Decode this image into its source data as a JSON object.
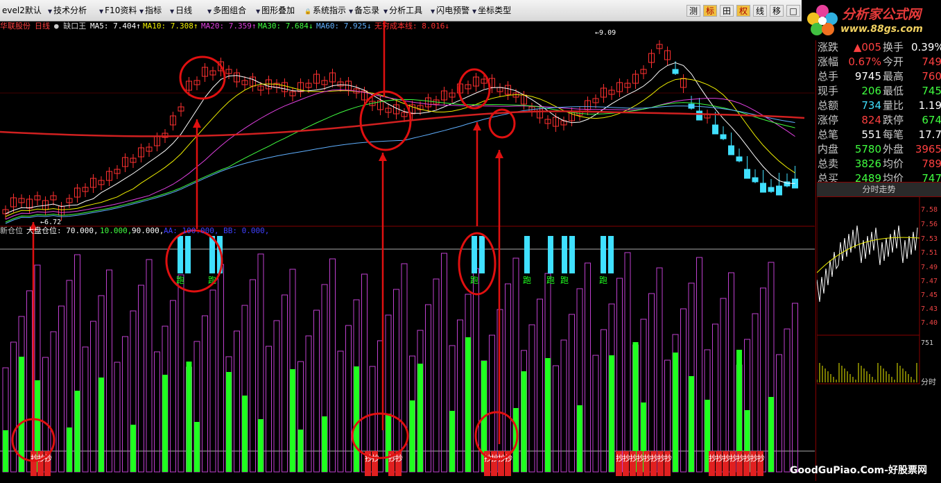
{
  "toolbar": {
    "items": [
      "evel2默认",
      "技术分析",
      "F10资料",
      "指标",
      "日线",
      "多图组合",
      "图形叠加",
      "系统指示",
      "备忘录",
      "分析工具",
      "闪电预警",
      "坐标类型"
    ],
    "right_buttons": [
      "测",
      "标",
      "田",
      "权",
      "线",
      "移",
      "□"
    ]
  },
  "logo": {
    "text": "分析家公式网",
    "url": "www.88gs.com"
  },
  "header": {
    "stock": "华联股份",
    "period": "日线",
    "indicator": "缺口王",
    "ma5": "MA5: 7.404↑",
    "ma10": "MA10: 7.308↑",
    "ma20": "MA20: 7.359↑",
    "ma30": "MA30: 7.684↓",
    "ma60": "MA60: 7.925↓",
    "cost": "无穷成本线: 8.016↓"
  },
  "price_labels": {
    "high": "9.09",
    "low": "6.72"
  },
  "lower": {
    "title": "新仓位",
    "line2": "大盘仓位: 70.000,",
    "v1": "10.000,",
    "v2": "90.000,",
    "v3": "AA: 100.000, BB: 0.000,"
  },
  "signals": {
    "run": "跑",
    "buy": "抄"
  },
  "quotes": [
    {
      "l1": "涨跌",
      "v1": "▲005",
      "c1": "#ff4040",
      "l2": "换手",
      "v2": "0.39%",
      "c2": "#ffffff"
    },
    {
      "l1": "涨幅",
      "v1": "0.67%",
      "c1": "#ff4040",
      "l2": "今开",
      "v2": "749",
      "c2": "#ff4040"
    },
    {
      "l1": "总手",
      "v1": "9745",
      "c1": "#ffffff",
      "l2": "最高",
      "v2": "760",
      "c2": "#ff4040"
    },
    {
      "l1": "现手",
      "v1": "206",
      "c1": "#40ff40",
      "l2": "最低",
      "v2": "745",
      "c2": "#40ff40"
    },
    {
      "l1": "总额",
      "v1": "734",
      "c1": "#40e0ff",
      "l2": "量比",
      "v2": "1.19",
      "c2": "#ffffff"
    },
    {
      "l1": "涨停",
      "v1": "824",
      "c1": "#ff4040",
      "l2": "跌停",
      "v2": "674",
      "c2": "#40ff40"
    },
    {
      "l1": "总笔",
      "v1": "551",
      "c1": "#ffffff",
      "l2": "每笔",
      "v2": "17.7",
      "c2": "#ffffff"
    },
    {
      "l1": "内盘",
      "v1": "5780",
      "c1": "#40ff40",
      "l2": "外盘",
      "v2": "3965",
      "c2": "#ff4040"
    },
    {
      "l1": "总卖",
      "v1": "3826",
      "c1": "#40ff40",
      "l2": "均价",
      "v2": "789",
      "c2": "#ff4040"
    },
    {
      "l1": "总买",
      "v1": "2489",
      "c1": "#40ff40",
      "l2": "均价",
      "v2": "747",
      "c2": "#40ff40"
    }
  ],
  "intraday": {
    "title": "分时走势",
    "axis": [
      "7.58",
      "7.56",
      "7.53",
      "7.51",
      "7.49",
      "7.47",
      "7.45",
      "7.43",
      "7.40"
    ],
    "vol": "751",
    "time": "分时"
  },
  "watermark": "GoodGuPiao.Com-好股票网",
  "colors": {
    "up": "#ff3030",
    "down": "#40e0ff",
    "cost": "#d02020",
    "green": "#20ff20",
    "purple": "#c040d0"
  }
}
